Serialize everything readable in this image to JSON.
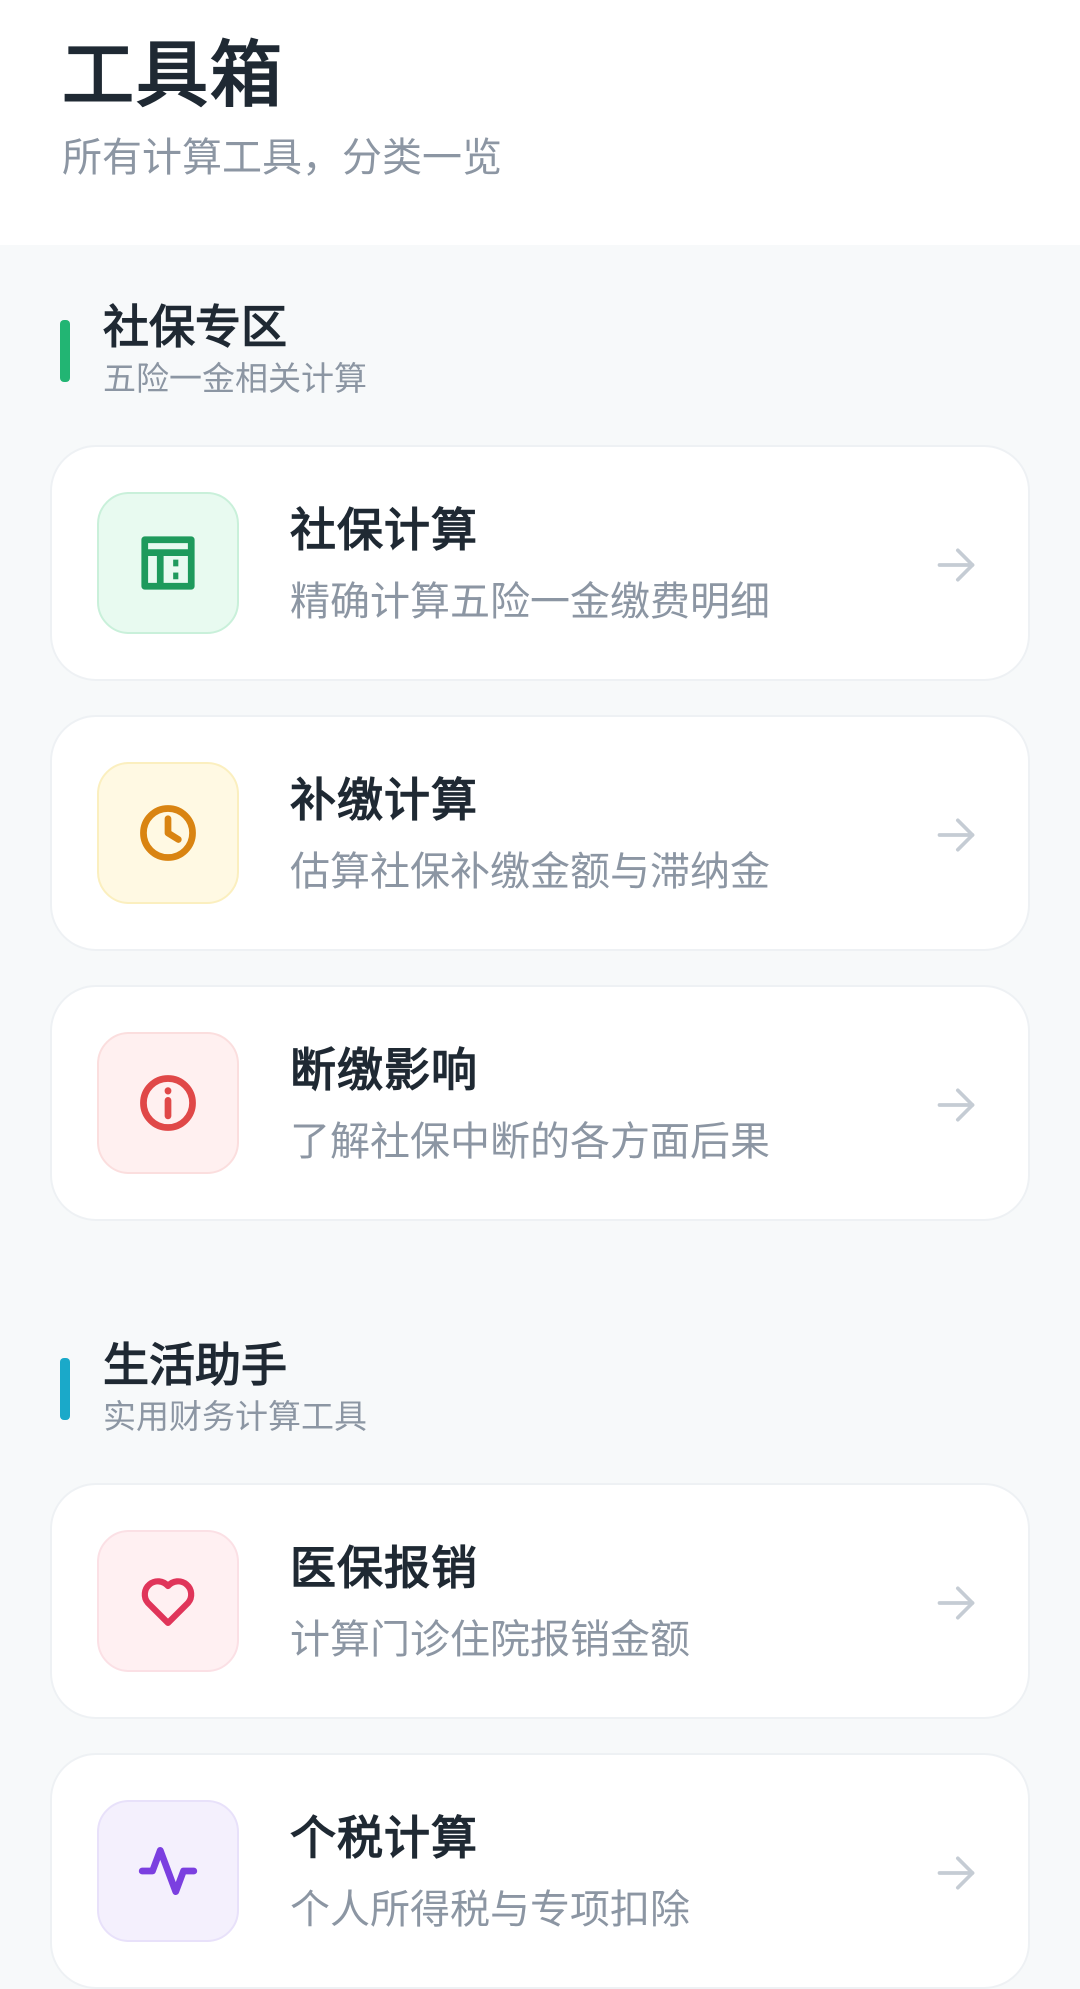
{
  "header": {
    "title": "工具箱",
    "subtitle": "所有计算工具，分类一览"
  },
  "sections": [
    {
      "title": "社保专区",
      "subtitle": "五险一金相关计算",
      "accent": "#22b573",
      "cards": [
        {
          "title": "社保计算",
          "desc": "精确计算五险一金缴费明细",
          "icon": "table-icon",
          "icon_color": "#1e9a5c",
          "icon_bg": "#e8faf0",
          "icon_border": "#c9f0da"
        },
        {
          "title": "补缴计算",
          "desc": "估算社保补缴金额与滞纳金",
          "icon": "clock-icon",
          "icon_color": "#d98412",
          "icon_bg": "#fff9e3",
          "icon_border": "#fbefbf"
        },
        {
          "title": "断缴影响",
          "desc": "了解社保中断的各方面后果",
          "icon": "info-icon",
          "icon_color": "#e04848",
          "icon_bg": "#fff0f0",
          "icon_border": "#fbdede"
        }
      ]
    },
    {
      "title": "生活助手",
      "subtitle": "实用财务计算工具",
      "accent": "#1aa9c9",
      "cards": [
        {
          "title": "医保报销",
          "desc": "计算门诊住院报销金额",
          "icon": "heart-icon",
          "icon_color": "#e0355a",
          "icon_bg": "#fff0f2",
          "icon_border": "#fbe0e5"
        },
        {
          "title": "个税计算",
          "desc": "个人所得税与专项扣除",
          "icon": "pulse-icon",
          "icon_color": "#7b3fe0",
          "icon_bg": "#f4f0fd",
          "icon_border": "#e8e1fa"
        }
      ]
    }
  ]
}
